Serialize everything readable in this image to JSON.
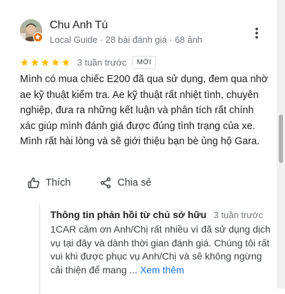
{
  "review": {
    "author": {
      "name": "Chu Anh Tú",
      "meta": "Local Guide · 28 bài đánh giá · 68 ảnh",
      "avatar": "avatar-photo",
      "badge_icon": "local-guide-star-icon"
    },
    "menu_icon": "more-vert-icon",
    "rating": 5,
    "rating_max": 5,
    "star_color": "#fbbc04",
    "time": "3 tuần trước",
    "badge": "MỚI",
    "text": "Mình có mua chiếc E200 đã qua sử dụng, đem qua nhờ ae kỹ thuật kiểm tra. Ae kỹ thuật rất nhiệt tình, chuyên nghiệp, đưa ra những kết luận và phân tích rất chính xác giúp mình đánh giá được đúng tình trạng của xe. Mình rất hài lòng và sẽ giới thiệu bạn bè ủng hộ Gara.",
    "actions": {
      "like_label": "Thích",
      "like_icon": "thumb-up-icon",
      "share_label": "Chia sẻ",
      "share_icon": "share-icon"
    },
    "owner_response": {
      "title": "Thông tin phản hồi từ chủ sở hữu",
      "time": "3 tuần trước",
      "text": "1CAR cảm ơn Anh/Chị rất nhiều vì đã sử dụng dịch vụ tại đây và dành thời gian đánh giá. Chúng tôi rất vui khi được phục vụ Anh/Chị và sẽ không ngừng cải thiện để mang ...",
      "more_label": "Xem thêm",
      "more_color": "#1a73e8"
    }
  }
}
